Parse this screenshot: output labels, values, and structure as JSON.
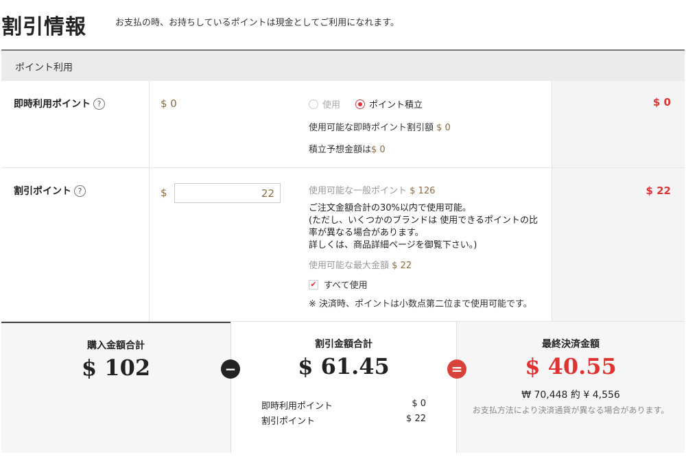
{
  "header": {
    "title": "割引情報",
    "note": "お支払の時、お持ちしているポイントは現金としてご利用になれます。"
  },
  "section": {
    "title": "ポイント利用"
  },
  "instant_points": {
    "label": "即時利用ポイント",
    "help": "?",
    "value": "$ 0",
    "radio_use": "使用",
    "radio_accumulate": "ポイント積立",
    "available_label": "使用可能な即時ポイント割引額",
    "available_value": "$ 0",
    "accumulate_label": "積立予想金額は",
    "accumulate_value": "$ 0",
    "amount": "$ 0"
  },
  "discount_points": {
    "label": "割引ポイント",
    "help": "?",
    "currency": "$",
    "input_value": "22",
    "general_label": "使用可能な一般ポイント",
    "general_value": "$ 126",
    "notice_1": "ご注文金額合計の30%以内で使用可能。",
    "notice_2": "(ただし、いくつかのブランドは 使用できるポイントの比率が異なる場合があります。",
    "notice_3": "詳しくは、商品詳細ページを御覧下さい。)",
    "max_label": "使用可能な最大金額",
    "max_value": "$ 22",
    "use_all_label": "すべて使用",
    "decimal_note": "※ 決済時、ポイントは小数点第二位まで使用可能です。",
    "amount": "$ 22"
  },
  "summary": {
    "purchase_title": "購入金額合計",
    "purchase_value": "$ 102",
    "minus_symbol": "−",
    "discount_title": "割引金額合計",
    "discount_value": "$ 61.45",
    "breakdown": [
      {
        "label": "即時利用ポイント",
        "value": "$ 0"
      },
      {
        "label": "割引ポイント",
        "value": "$ 22"
      }
    ],
    "equals_symbol": "=",
    "final_title": "最終決済金額",
    "final_value": "$ 40.55",
    "conversion": "₩ 70,448 約 ¥ 4,556",
    "conversion_note": "お支払方法により決済通貨が異なる場合があります。"
  },
  "colors": {
    "accent_red": "#d33333",
    "value_brown": "#8c6a3f"
  }
}
